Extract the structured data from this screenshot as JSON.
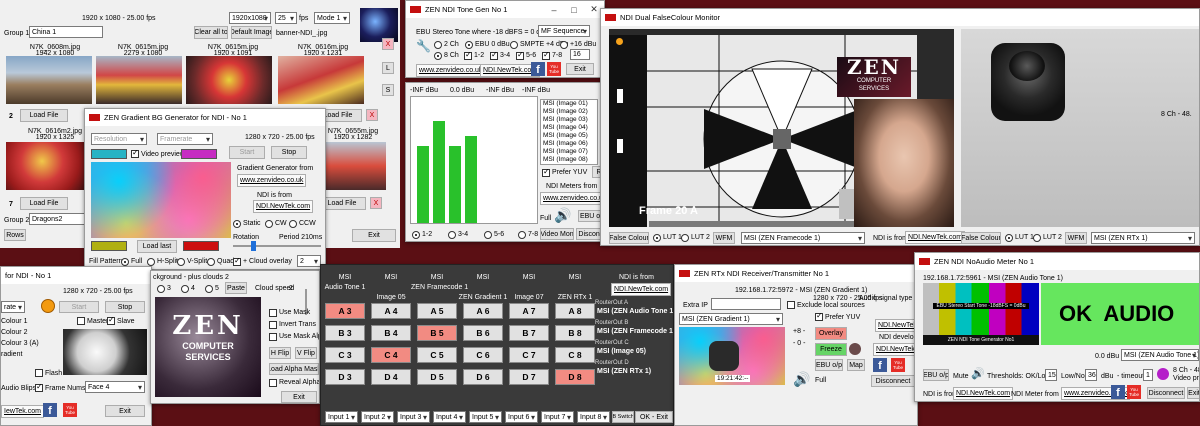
{
  "app1": {
    "res_label": "1920 x 1080 - 25.00 fps",
    "res_select": "1920x1080",
    "fps_select": "25",
    "fps_label": "fps",
    "mode_select": "Mode 1",
    "group1_label": "Group 1",
    "group1_value": "China 1",
    "clear_label": "Clear all to",
    "default_image_label": "Default Image",
    "banner_file": "banner-NDI_.jpg",
    "images": [
      {
        "file": "N7K_0608m.jpg",
        "size": "1942 x 1080"
      },
      {
        "file": "N7K_0615m.jpg",
        "size": "2279 x 1080"
      },
      {
        "file": "N7K_0615m.jpg",
        "size": "1920 x 1091"
      },
      {
        "file": "N7K_0616m.jpg",
        "size": "1920 x 1231"
      }
    ],
    "images_row2": [
      {
        "file": "N7K_0616m2.jpg",
        "size": "1920 x 1325"
      },
      {
        "file": "N7K_0655m.jpg",
        "size": "1920 x 1282"
      }
    ],
    "load_file_label": "Load File",
    "row_number_2": "2",
    "row_number_7": "7",
    "side_x": "X",
    "side_l": "L",
    "side_s": "S",
    "group2_label": "Group 2",
    "group2_value": "Dragons2",
    "rows_label": "Rows",
    "exit_label": "Exit"
  },
  "gradient": {
    "title": "ZEN Gradient BG Generator for NDI - No 1",
    "resolution_label": "Resolution",
    "framerate_label": "Framerate",
    "res_label": "1280 x 720 - 25.00 fps",
    "start_label": "Start",
    "stop_label": "Stop",
    "video_preview_label": "Video preview",
    "generator_from": "Gradient Generator from",
    "zenvideo_link": "www.zenvideo.co.uk",
    "ndi_from": "NDI is from",
    "ndi_link": "NDI.NewTek.com",
    "load_last_label": "Load last",
    "static_label": "Static",
    "cw_label": "CW",
    "ccw_label": "CCW",
    "rotation_label": "Rotation",
    "period_label": "Period 210ms",
    "fill_pattern_label": "Fill Pattern",
    "fill_full": "Full",
    "fill_hsplit": "H-Split",
    "fill_vsplit": "V-Split",
    "fill_quad": "Quad",
    "cloud_overlay_label": "+ Cloud overlay",
    "cloud_value": "2",
    "swatch1": "#27b3c4",
    "swatch2": "#c62cc2",
    "swatch3": "#b0b011",
    "swatch4": "#cc0f0f"
  },
  "bg": {
    "title": "for NDI - No 1",
    "subtitle": "ckground - plus clouds 2",
    "res_label": "1280 x 720 - 25.00 fps",
    "rate_value": "rate",
    "start_label": "Start",
    "stop_label": "Stop",
    "colour1": "Colour 1",
    "colour2": "Colour 2",
    "colour3": "Colour 3 (A)",
    "gradient_label": "radient",
    "master_label": "Master",
    "slave_label": "Slave",
    "flash_label": "Flash",
    "audio_blips": "Audio Blips",
    "frame_nums": "Frame Nums",
    "face_value": "Face 4",
    "ndi_link": "IewTek.com",
    "exit_label": "Exit",
    "opt3": "3",
    "opt4": "4",
    "opt5": "5",
    "paste_label": "Paste",
    "cloud_speed": "Cloud speed",
    "cloud_speed_val": "2",
    "use_mask": "Use Mask",
    "invert_trans": "Invert Trans",
    "use_mask_alpha": "Use Mask Alpha",
    "hflip": "H Flip",
    "vflip": "V Flip",
    "load_alpha": "Load Alpha Mask",
    "reveal_alpha": "Reveal Alpha",
    "exit2": "Exit",
    "zen_big": "ZEN",
    "zen_sub1": "COMPUTER",
    "zen_sub2": "SERVICES"
  },
  "router": {
    "headers": [
      "MSI",
      "MSI",
      "MSI",
      "MSI",
      "MSI",
      "MSI"
    ],
    "subheaders": [
      "Audio Tone 1",
      "",
      "ZEN Framecode 1",
      "",
      "",
      ""
    ],
    "sub2": [
      "",
      "Image 05",
      "",
      "ZEN Gradient 1",
      "Image 07",
      "ZEN RTx 1"
    ],
    "rows": [
      [
        "A 3",
        "A 4",
        "A 5",
        "A 6",
        "A 7",
        "A 8"
      ],
      [
        "B 3",
        "B 4",
        "B 5",
        "B 6",
        "B 7",
        "B 8"
      ],
      [
        "C 3",
        "C 4",
        "C 5",
        "C 6",
        "C 7",
        "C 8"
      ],
      [
        "D 3",
        "D 4",
        "D 5",
        "D 6",
        "D 7",
        "D 8"
      ]
    ],
    "active": [
      [
        true,
        false,
        false,
        false,
        false,
        false
      ],
      [
        false,
        false,
        true,
        false,
        false,
        false
      ],
      [
        false,
        true,
        false,
        false,
        false,
        false
      ],
      [
        false,
        false,
        false,
        false,
        false,
        true
      ]
    ],
    "ndi_from": "NDI is from",
    "ndi_link": "NDI.NewTek.com",
    "outs": [
      {
        "label": "RouterOut A",
        "value": "MSI (ZEN Audio Tone 1)"
      },
      {
        "label": "RouterOut B",
        "value": "MSI (ZEN Framecode 1)"
      },
      {
        "label": "RouterOut C",
        "value": "MSI (Image 05)"
      },
      {
        "label": "RouterOut D",
        "value": "MSI (ZEN RTx 1)"
      }
    ],
    "inputs": [
      "Input 1",
      "Input 2",
      "Input 3",
      "Input 4",
      "Input 5",
      "Input 6",
      "Input 7",
      "Input 8"
    ],
    "ab_switcher": "A/B Switcher",
    "ok_exit": "OK - Exit"
  },
  "tone": {
    "title": "ZEN NDI Tone Gen No 1",
    "ebu_label": "EBU Stereo Tone where -18 dBFS = 0 dBu",
    "mf_select": "MF Sequence",
    "ch2": "2 Ch",
    "ebu0": "EBU 0 dBu",
    "smpte": "SMPTE +4 dBu",
    "dbu16": "+16 dBu",
    "ch8": "8 Ch",
    "c12": "1-2",
    "c34": "3-4",
    "c56": "5-6",
    "c78": "7-8",
    "num": "16",
    "zenvideo_link": "www.zenvideo.co.uk",
    "ndi_link": "NDI.NewTek.com",
    "exit_label": "Exit"
  },
  "meters": {
    "scale": [
      "-INF dBu",
      "0.0 dBu",
      "-INF dBu",
      "-INF dBu"
    ],
    "levels": [
      0.62,
      0.82,
      0.62,
      0.7,
      0.0,
      0.0,
      0.0,
      0.0
    ],
    "sources": [
      "MSI (Image 01)",
      "MSI (Image 02)",
      "MSI (Image 03)",
      "MSI (Image 04)",
      "MSI (Image 05)",
      "MSI (Image 06)",
      "MSI (Image 07)",
      "MSI (Image 08)"
    ],
    "prefer_yuv": "Prefer YUV",
    "re": "Re",
    "ndi_meters_from": "NDI Meters from",
    "zenvideo_link": "www.zenvideo.co.uk",
    "full": "Full",
    "ebu_label": "EBU o/p",
    "ch12": "1-2",
    "ch34": "3-4",
    "ch56": "5-6",
    "ch78": "7-8",
    "video_mon": "Video Mon",
    "disconnect": "Disconne"
  },
  "monitor": {
    "title": "NDI Dual FalseColour Monitor",
    "overlay_text": "Frame 20 A",
    "zen_big": "ZEN",
    "zen_sub1": "COMPUTER",
    "zen_sub2": "SERVICES",
    "ch_label": "8 Ch - 48.",
    "false_colour": "False Colour",
    "lut1": "LUT 1",
    "lut2": "LUT 2",
    "wfm": "WFM",
    "source_left": "MSI (ZEN Framecode 1)",
    "ndi_from": "NDI is from",
    "ndi_link": "NDI.NewTek.com",
    "false_colour_r": "False Colour",
    "lut1_r": "LUT 1",
    "lut2_r": "LUT 2",
    "wfm_r": "WFM",
    "source_right": "MSI (ZEN RTx 1)"
  },
  "rtx": {
    "title": "ZEN RTx NDI Receiver/Transmitter No 1",
    "addr": "192.168.1.72:5972 - MSI (ZEN Gradient 1)",
    "res": "1280 x 720 - 25.00 fps",
    "extra_ip": "Extra IP",
    "exclude_local": "Exclude local sources",
    "audio_signal": "Audio signal type",
    "source_select": "MSI (ZEN Gradient 1)",
    "prefer_yuv": "Prefer YUV",
    "ndi_link": "NDI.NewTek.com",
    "overlay": "Overlay",
    "freeze": "Freeze",
    "ebu_op": "EBU o/p",
    "map": "Map",
    "full": "Full",
    "timecode": "19:21:42:--",
    "plus8": "+8 -",
    "minus0": "- 0 -",
    "ndi_dev": "NDI develope",
    "ndi_link2": "NDI.NewTek.",
    "disconnect": "Disconnect"
  },
  "noaudio": {
    "title": "ZEN NDI NoAudio Meter No 1",
    "addr": "192.168.1.72:5961 - MSI (ZEN Audio Tone 1)",
    "ok_text": "OK  AUDIO",
    "bars_caption": "EBU Stereo Start Tone -18dBFS = 0dBu",
    "bars_footer": "ZEN NDI Tone Generator No1",
    "level": "0.0 dBu",
    "source": "MSI (ZEN Audio Tone 1)",
    "ebu_op": "EBU o/p",
    "mute": "Mute",
    "thresholds": "Thresholds: OK/Low -",
    "th1": "15",
    "low_no": "Low/No -",
    "th2": "36",
    "dbu": "dBu",
    "timeout": "- timeout",
    "th3": "1",
    "ch": "8 Ch - 48.",
    "video_pres": "Video pres",
    "ndi_from": "NDI is from",
    "ndi_link": "NDI.NewTek.com",
    "meter_from": "NDI Meter from",
    "zen_link": "www.zenvideo.co.uk",
    "disconnect": "Disconnect",
    "exit": "Exit"
  }
}
